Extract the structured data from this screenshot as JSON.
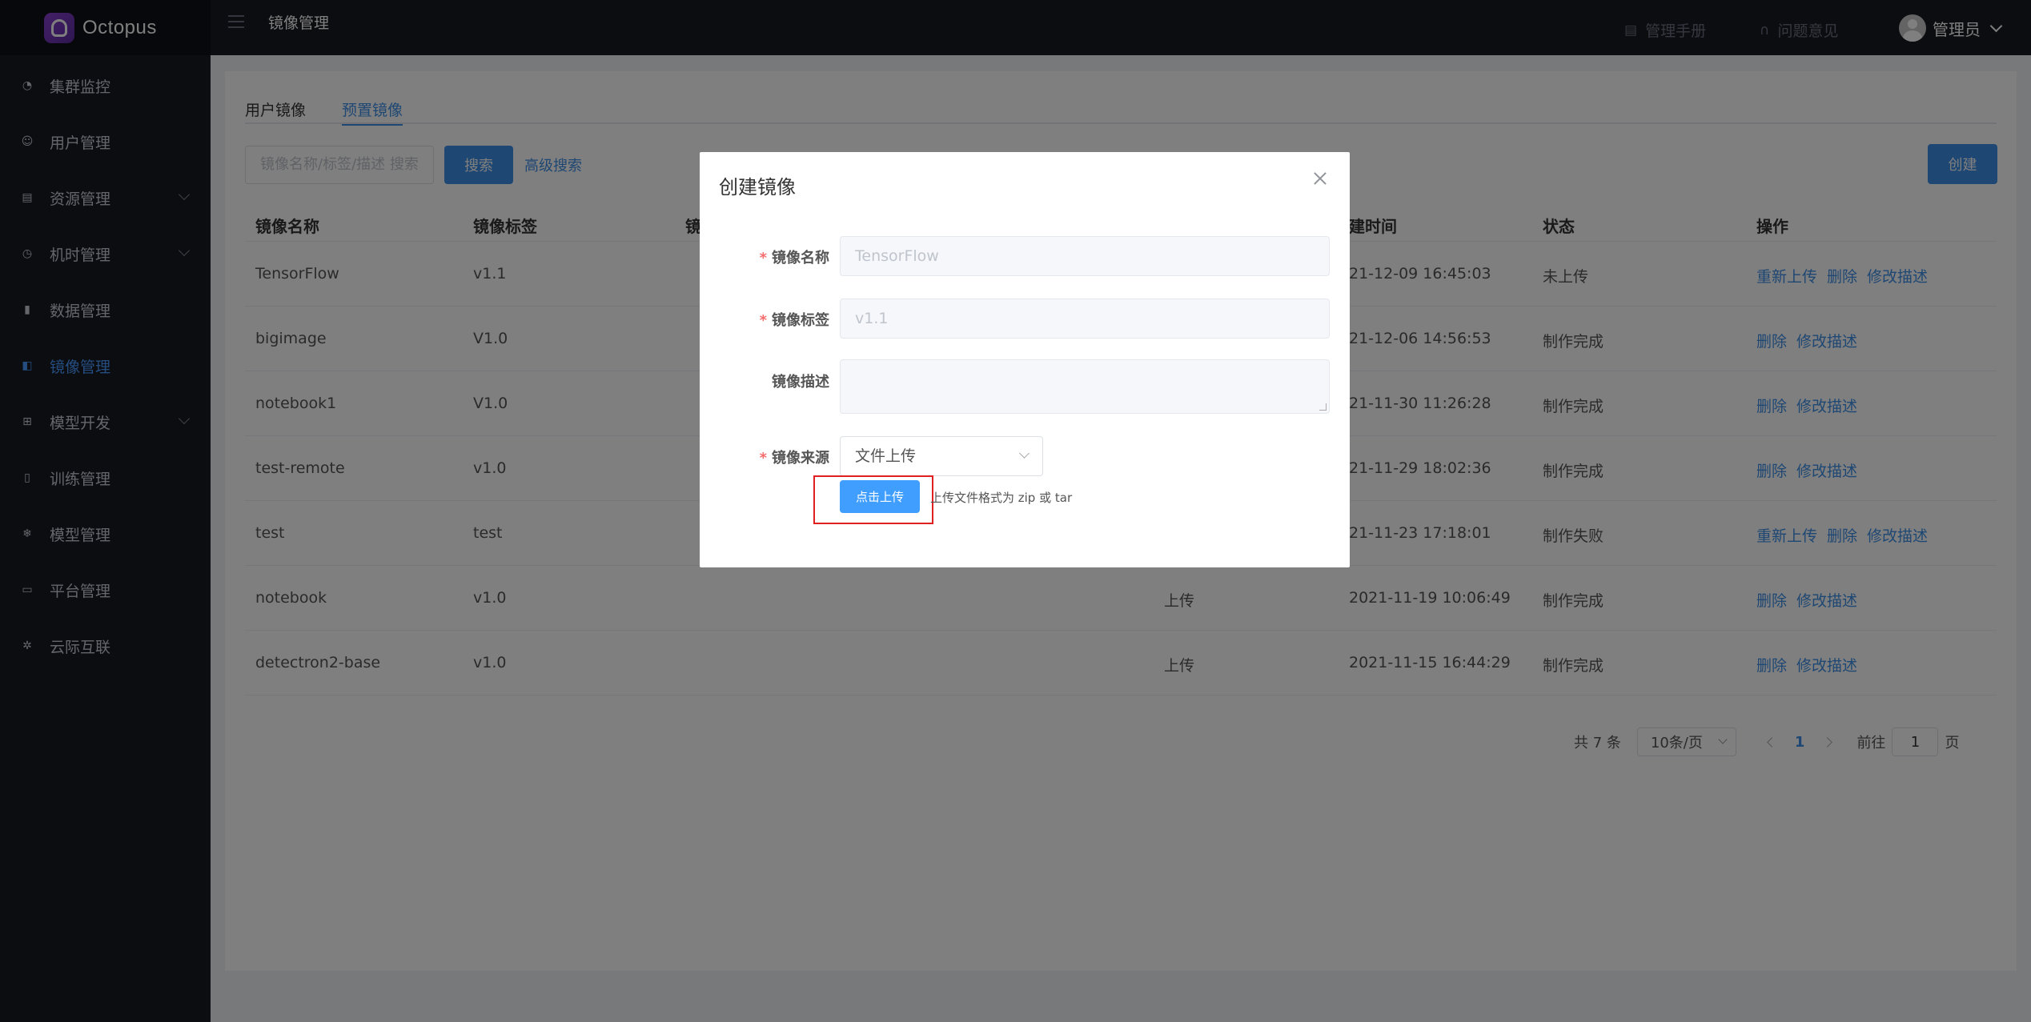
{
  "app": {
    "name": "Octopus"
  },
  "header": {
    "title": "镜像管理",
    "manual_label": "管理手册",
    "feedback_label": "问题意见",
    "user_name": "管理员"
  },
  "sidebar": {
    "items": [
      {
        "label": "集群监控",
        "icon": "dashboard-icon",
        "expandable": false,
        "active": false
      },
      {
        "label": "用户管理",
        "icon": "user-icon",
        "expandable": false,
        "active": false
      },
      {
        "label": "资源管理",
        "icon": "clipboard-icon",
        "expandable": true,
        "active": false
      },
      {
        "label": "机时管理",
        "icon": "clock-icon",
        "expandable": true,
        "active": false
      },
      {
        "label": "数据管理",
        "icon": "database-icon",
        "expandable": false,
        "active": false
      },
      {
        "label": "镜像管理",
        "icon": "image-icon",
        "expandable": false,
        "active": true
      },
      {
        "label": "模型开发",
        "icon": "grid-icon",
        "expandable": true,
        "active": false
      },
      {
        "label": "训练管理",
        "icon": "document-icon",
        "expandable": false,
        "active": false
      },
      {
        "label": "模型管理",
        "icon": "gear-icon",
        "expandable": false,
        "active": false
      },
      {
        "label": "平台管理",
        "icon": "monitor-icon",
        "expandable": false,
        "active": false
      },
      {
        "label": "云际互联",
        "icon": "link-icon",
        "expandable": false,
        "active": false
      }
    ]
  },
  "tabs": [
    {
      "label": "用户镜像",
      "active": false
    },
    {
      "label": "预置镜像",
      "active": true
    }
  ],
  "search": {
    "placeholder": "镜像名称/标签/描述 搜索",
    "button_label": "搜索",
    "advanced_label": "高级搜索",
    "create_label": "创建"
  },
  "table": {
    "headers": [
      "镜像名称",
      "镜像标签",
      "镜",
      "建时间",
      "状态",
      "操作"
    ],
    "rows": [
      {
        "name": "TensorFlow",
        "tag": "v1.1",
        "source": "",
        "created": "21-12-09 16:45:03",
        "status": "未上传",
        "ops": [
          "重新上传",
          "删除",
          "修改描述"
        ]
      },
      {
        "name": "bigimage",
        "tag": "V1.0",
        "source": "",
        "created": "21-12-06 14:56:53",
        "status": "制作完成",
        "ops": [
          "删除",
          "修改描述"
        ]
      },
      {
        "name": "notebook1",
        "tag": "V1.0",
        "source": "",
        "created": "21-11-30 11:26:28",
        "status": "制作完成",
        "ops": [
          "删除",
          "修改描述"
        ]
      },
      {
        "name": "test-remote",
        "tag": "v1.0",
        "source": "",
        "created": "21-11-29 18:02:36",
        "status": "制作完成",
        "ops": [
          "删除",
          "修改描述"
        ]
      },
      {
        "name": "test",
        "tag": "test",
        "source": "",
        "created": "21-11-23 17:18:01",
        "status": "制作失败",
        "ops": [
          "重新上传",
          "删除",
          "修改描述"
        ]
      },
      {
        "name": "notebook",
        "tag": "v1.0",
        "source": "上传",
        "created": "2021-11-19 10:06:49",
        "status": "制作完成",
        "ops": [
          "删除",
          "修改描述"
        ]
      },
      {
        "name": "detectron2-base",
        "tag": "v1.0",
        "source": "上传",
        "created": "2021-11-15 16:44:29",
        "status": "制作完成",
        "ops": [
          "删除",
          "修改描述"
        ]
      }
    ]
  },
  "pagination": {
    "total_label": "共 7 条",
    "page_size": "10条/页",
    "current_page": "1",
    "goto_label": "前往",
    "goto_value": "1",
    "page_suffix": "页"
  },
  "dialog": {
    "title": "创建镜像",
    "name_label": "镜像名称",
    "name_value": "TensorFlow",
    "tag_label": "镜像标签",
    "tag_value": "v1.1",
    "desc_label": "镜像描述",
    "desc_value": "",
    "source_label": "镜像来源",
    "source_value": "文件上传",
    "upload_button": "点击上传",
    "upload_tip": "上传文件格式为 zip 或 tar",
    "required_mark": "*"
  },
  "colors": {
    "accent": "#3d8ee6",
    "sidebar_bg": "#191a23",
    "required": "#f56c6c",
    "highlight": "#e02020"
  }
}
